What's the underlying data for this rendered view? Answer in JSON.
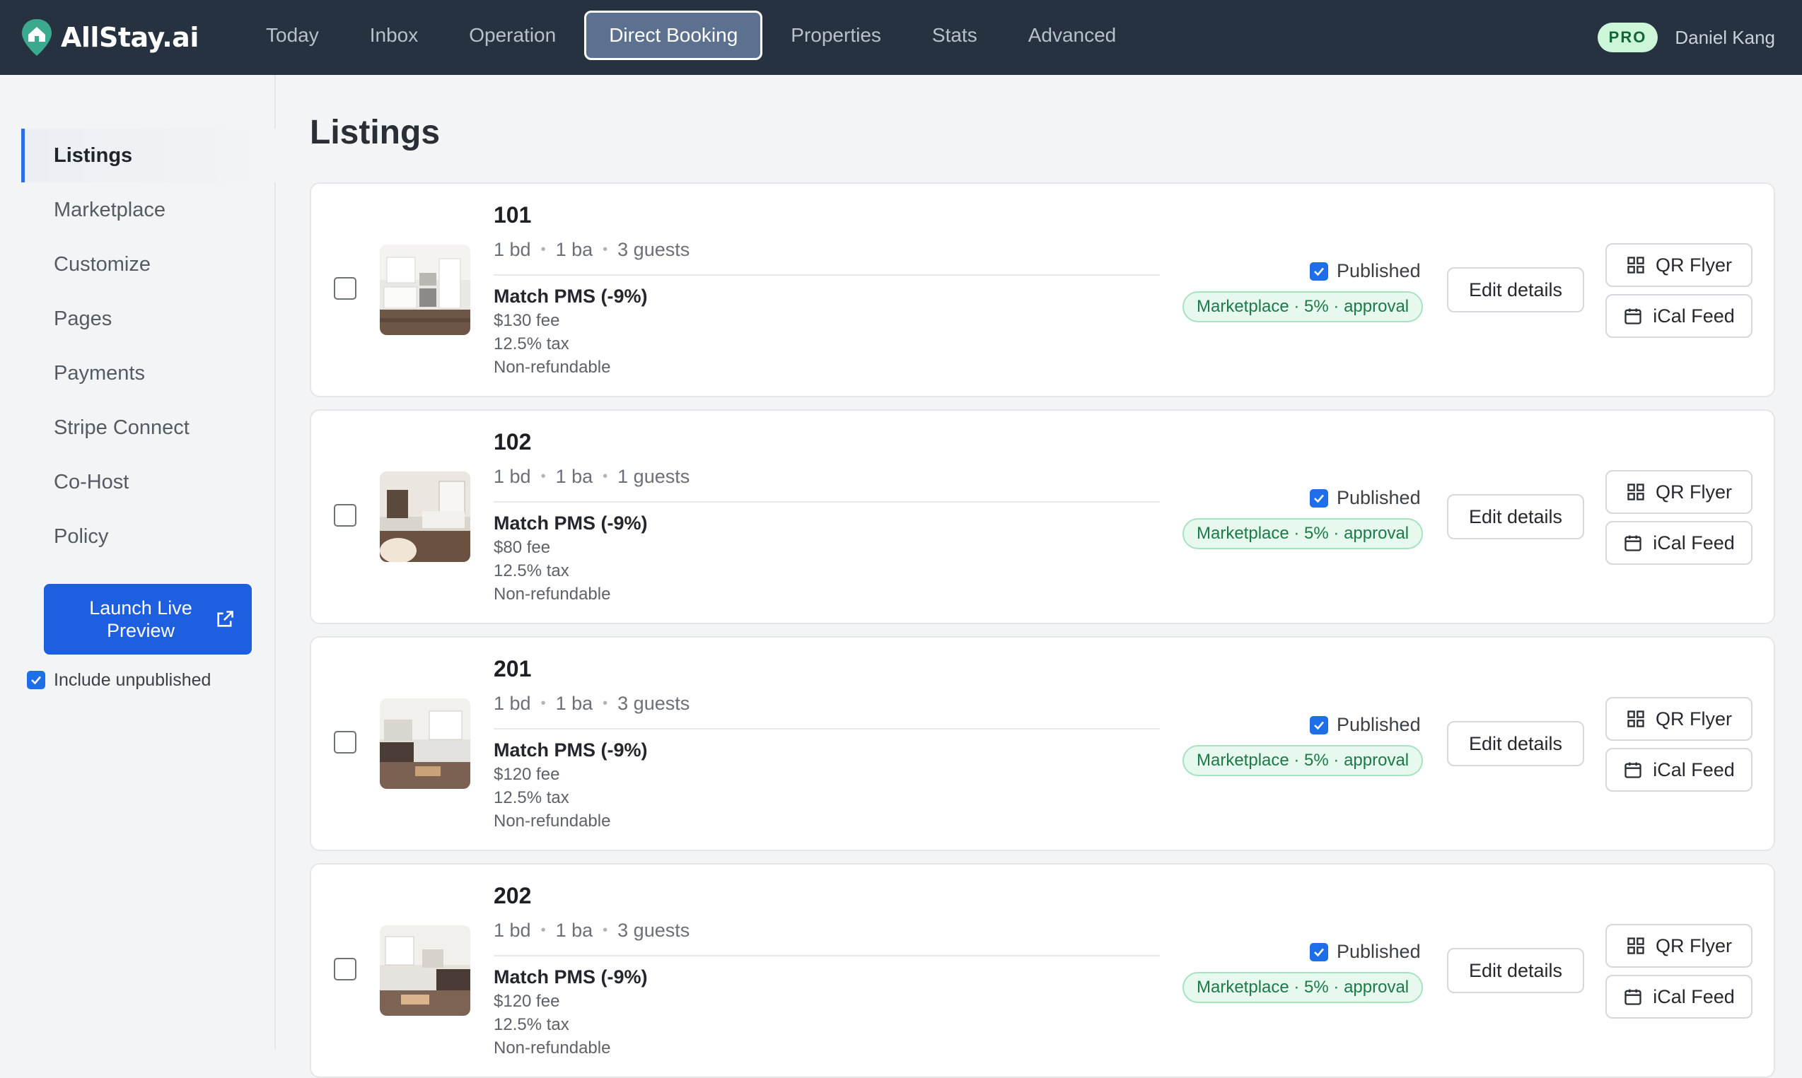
{
  "app": {
    "name": "AllStay.ai"
  },
  "nav": {
    "items": [
      "Today",
      "Inbox",
      "Operation",
      "Direct Booking",
      "Properties",
      "Stats",
      "Advanced"
    ],
    "active": "Direct Booking"
  },
  "user": {
    "badge": "PRO",
    "name": "Daniel Kang"
  },
  "sidebar": {
    "items": [
      "Listings",
      "Marketplace",
      "Customize",
      "Pages",
      "Payments",
      "Stripe Connect",
      "Co-Host",
      "Policy"
    ],
    "active": "Listings",
    "launch_label": "Launch Live Preview",
    "include_unpublished_label": "Include unpublished",
    "include_unpublished_checked": true
  },
  "page": {
    "title": "Listings"
  },
  "listings": [
    {
      "unit": "101",
      "bd": "1 bd",
      "ba": "1 ba",
      "guests": "3 guests",
      "pricing": "Match PMS (-9%)",
      "fee": "$130 fee",
      "tax": "12.5% tax",
      "refund": "Non-refundable",
      "published_label": "Published",
      "marketplace": "Marketplace · 5% · approval",
      "edit_label": "Edit details",
      "qr_label": "QR Flyer",
      "ical_label": "iCal Feed"
    },
    {
      "unit": "102",
      "bd": "1 bd",
      "ba": "1 ba",
      "guests": "1 guests",
      "pricing": "Match PMS (-9%)",
      "fee": "$80 fee",
      "tax": "12.5% tax",
      "refund": "Non-refundable",
      "published_label": "Published",
      "marketplace": "Marketplace · 5% · approval",
      "edit_label": "Edit details",
      "qr_label": "QR Flyer",
      "ical_label": "iCal Feed"
    },
    {
      "unit": "201",
      "bd": "1 bd",
      "ba": "1 ba",
      "guests": "3 guests",
      "pricing": "Match PMS (-9%)",
      "fee": "$120 fee",
      "tax": "12.5% tax",
      "refund": "Non-refundable",
      "published_label": "Published",
      "marketplace": "Marketplace · 5% · approval",
      "edit_label": "Edit details",
      "qr_label": "QR Flyer",
      "ical_label": "iCal Feed"
    },
    {
      "unit": "202",
      "bd": "1 bd",
      "ba": "1 ba",
      "guests": "3 guests",
      "pricing": "Match PMS (-9%)",
      "fee": "$120 fee",
      "tax": "12.5% tax",
      "refund": "Non-refundable",
      "published_label": "Published",
      "marketplace": "Marketplace · 5% · approval",
      "edit_label": "Edit details",
      "qr_label": "QR Flyer",
      "ical_label": "iCal Feed"
    }
  ],
  "colors": {
    "topbar": "#26323f",
    "accent": "#1e5fe0",
    "marketplace_bg": "#e7f8ee",
    "marketplace_text": "#1b7a47"
  }
}
